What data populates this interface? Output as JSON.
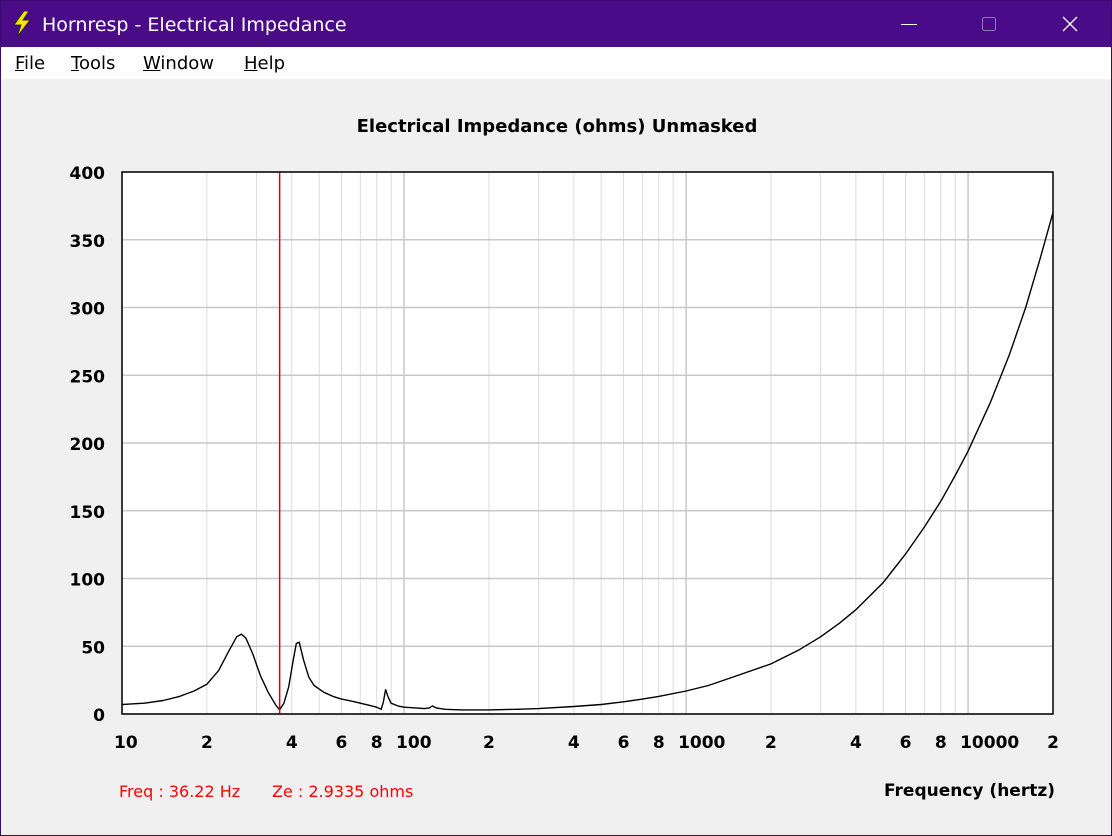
{
  "window": {
    "title": "Hornresp - Electrical Impedance",
    "icon": "lightning-icon",
    "controls": {
      "minimize": "minimize-icon",
      "maximize": "maximize-icon",
      "close": "close-icon"
    }
  },
  "menu": {
    "items": [
      {
        "label_first": "F",
        "label_rest": "ile"
      },
      {
        "label_first": "T",
        "label_rest": "ools"
      },
      {
        "label_first": "W",
        "label_rest": "indow"
      },
      {
        "label_first": "H",
        "label_rest": "elp"
      }
    ]
  },
  "readout": {
    "freq": "Freq : 36.22 Hz",
    "ze": "Ze : 2.9335 ohms"
  },
  "colors": {
    "titlebar": "#4a0b88",
    "curve": "#000000",
    "cursor": "#e00000",
    "grid": "#c8c8c8",
    "grid_minor": "#dcdcdc"
  },
  "chart_data": {
    "type": "line",
    "title": "Electrical Impedance (ohms)   Unmasked",
    "xlabel": "Frequency (hertz)",
    "ylabel": "",
    "xscale": "log",
    "xlim": [
      10,
      20000
    ],
    "ylim": [
      0,
      400
    ],
    "yticks": [
      0,
      50,
      100,
      150,
      200,
      250,
      300,
      350,
      400
    ],
    "xtick_labels": [
      {
        "value": 10,
        "label": "10"
      },
      {
        "value": 20,
        "label": "2"
      },
      {
        "value": 40,
        "label": "4"
      },
      {
        "value": 60,
        "label": "6"
      },
      {
        "value": 80,
        "label": "8"
      },
      {
        "value": 100,
        "label": "100"
      },
      {
        "value": 200,
        "label": "2"
      },
      {
        "value": 400,
        "label": "4"
      },
      {
        "value": 600,
        "label": "6"
      },
      {
        "value": 800,
        "label": "8"
      },
      {
        "value": 1000,
        "label": "1000"
      },
      {
        "value": 2000,
        "label": "2"
      },
      {
        "value": 4000,
        "label": "4"
      },
      {
        "value": 6000,
        "label": "6"
      },
      {
        "value": 8000,
        "label": "8"
      },
      {
        "value": 10000,
        "label": "10000"
      },
      {
        "value": 20000,
        "label": "2"
      }
    ],
    "grid": true,
    "cursor_x": 36.22,
    "series": [
      {
        "x": [
          10,
          12,
          14,
          16,
          18,
          20,
          22,
          24,
          25.5,
          26.5,
          27.5,
          29,
          31,
          33,
          35,
          36.22,
          37.5,
          39,
          40.5,
          41.5,
          42.5,
          44,
          46,
          48,
          52,
          56,
          60,
          65,
          70,
          75,
          80,
          83,
          84.5,
          86,
          88,
          90,
          95,
          100,
          110,
          118,
          123,
          126,
          130,
          140,
          160,
          180,
          200,
          250,
          300,
          400,
          500,
          600,
          700,
          800,
          1000,
          1200,
          1500,
          2000,
          2500,
          3000,
          3500,
          4000,
          5000,
          6000,
          7000,
          8000,
          9000,
          10000,
          12000,
          14000,
          16000,
          18000,
          20000
        ],
        "y": [
          7,
          8,
          10,
          13,
          17,
          22,
          32,
          47,
          57,
          59,
          56,
          45,
          28,
          16,
          7,
          3,
          8,
          20,
          40,
          52,
          53,
          40,
          27,
          21,
          16,
          13,
          11,
          9.5,
          8,
          6.5,
          5,
          3.5,
          9,
          18,
          12,
          8,
          6,
          5,
          4.5,
          4,
          4.5,
          6,
          4.5,
          3.5,
          3,
          3,
          3,
          3.5,
          4,
          5.5,
          7,
          9,
          11,
          13,
          17,
          21,
          28,
          37,
          47,
          57,
          67,
          77,
          97,
          118,
          138,
          157,
          176,
          194,
          230,
          265,
          300,
          336,
          370
        ]
      }
    ]
  }
}
